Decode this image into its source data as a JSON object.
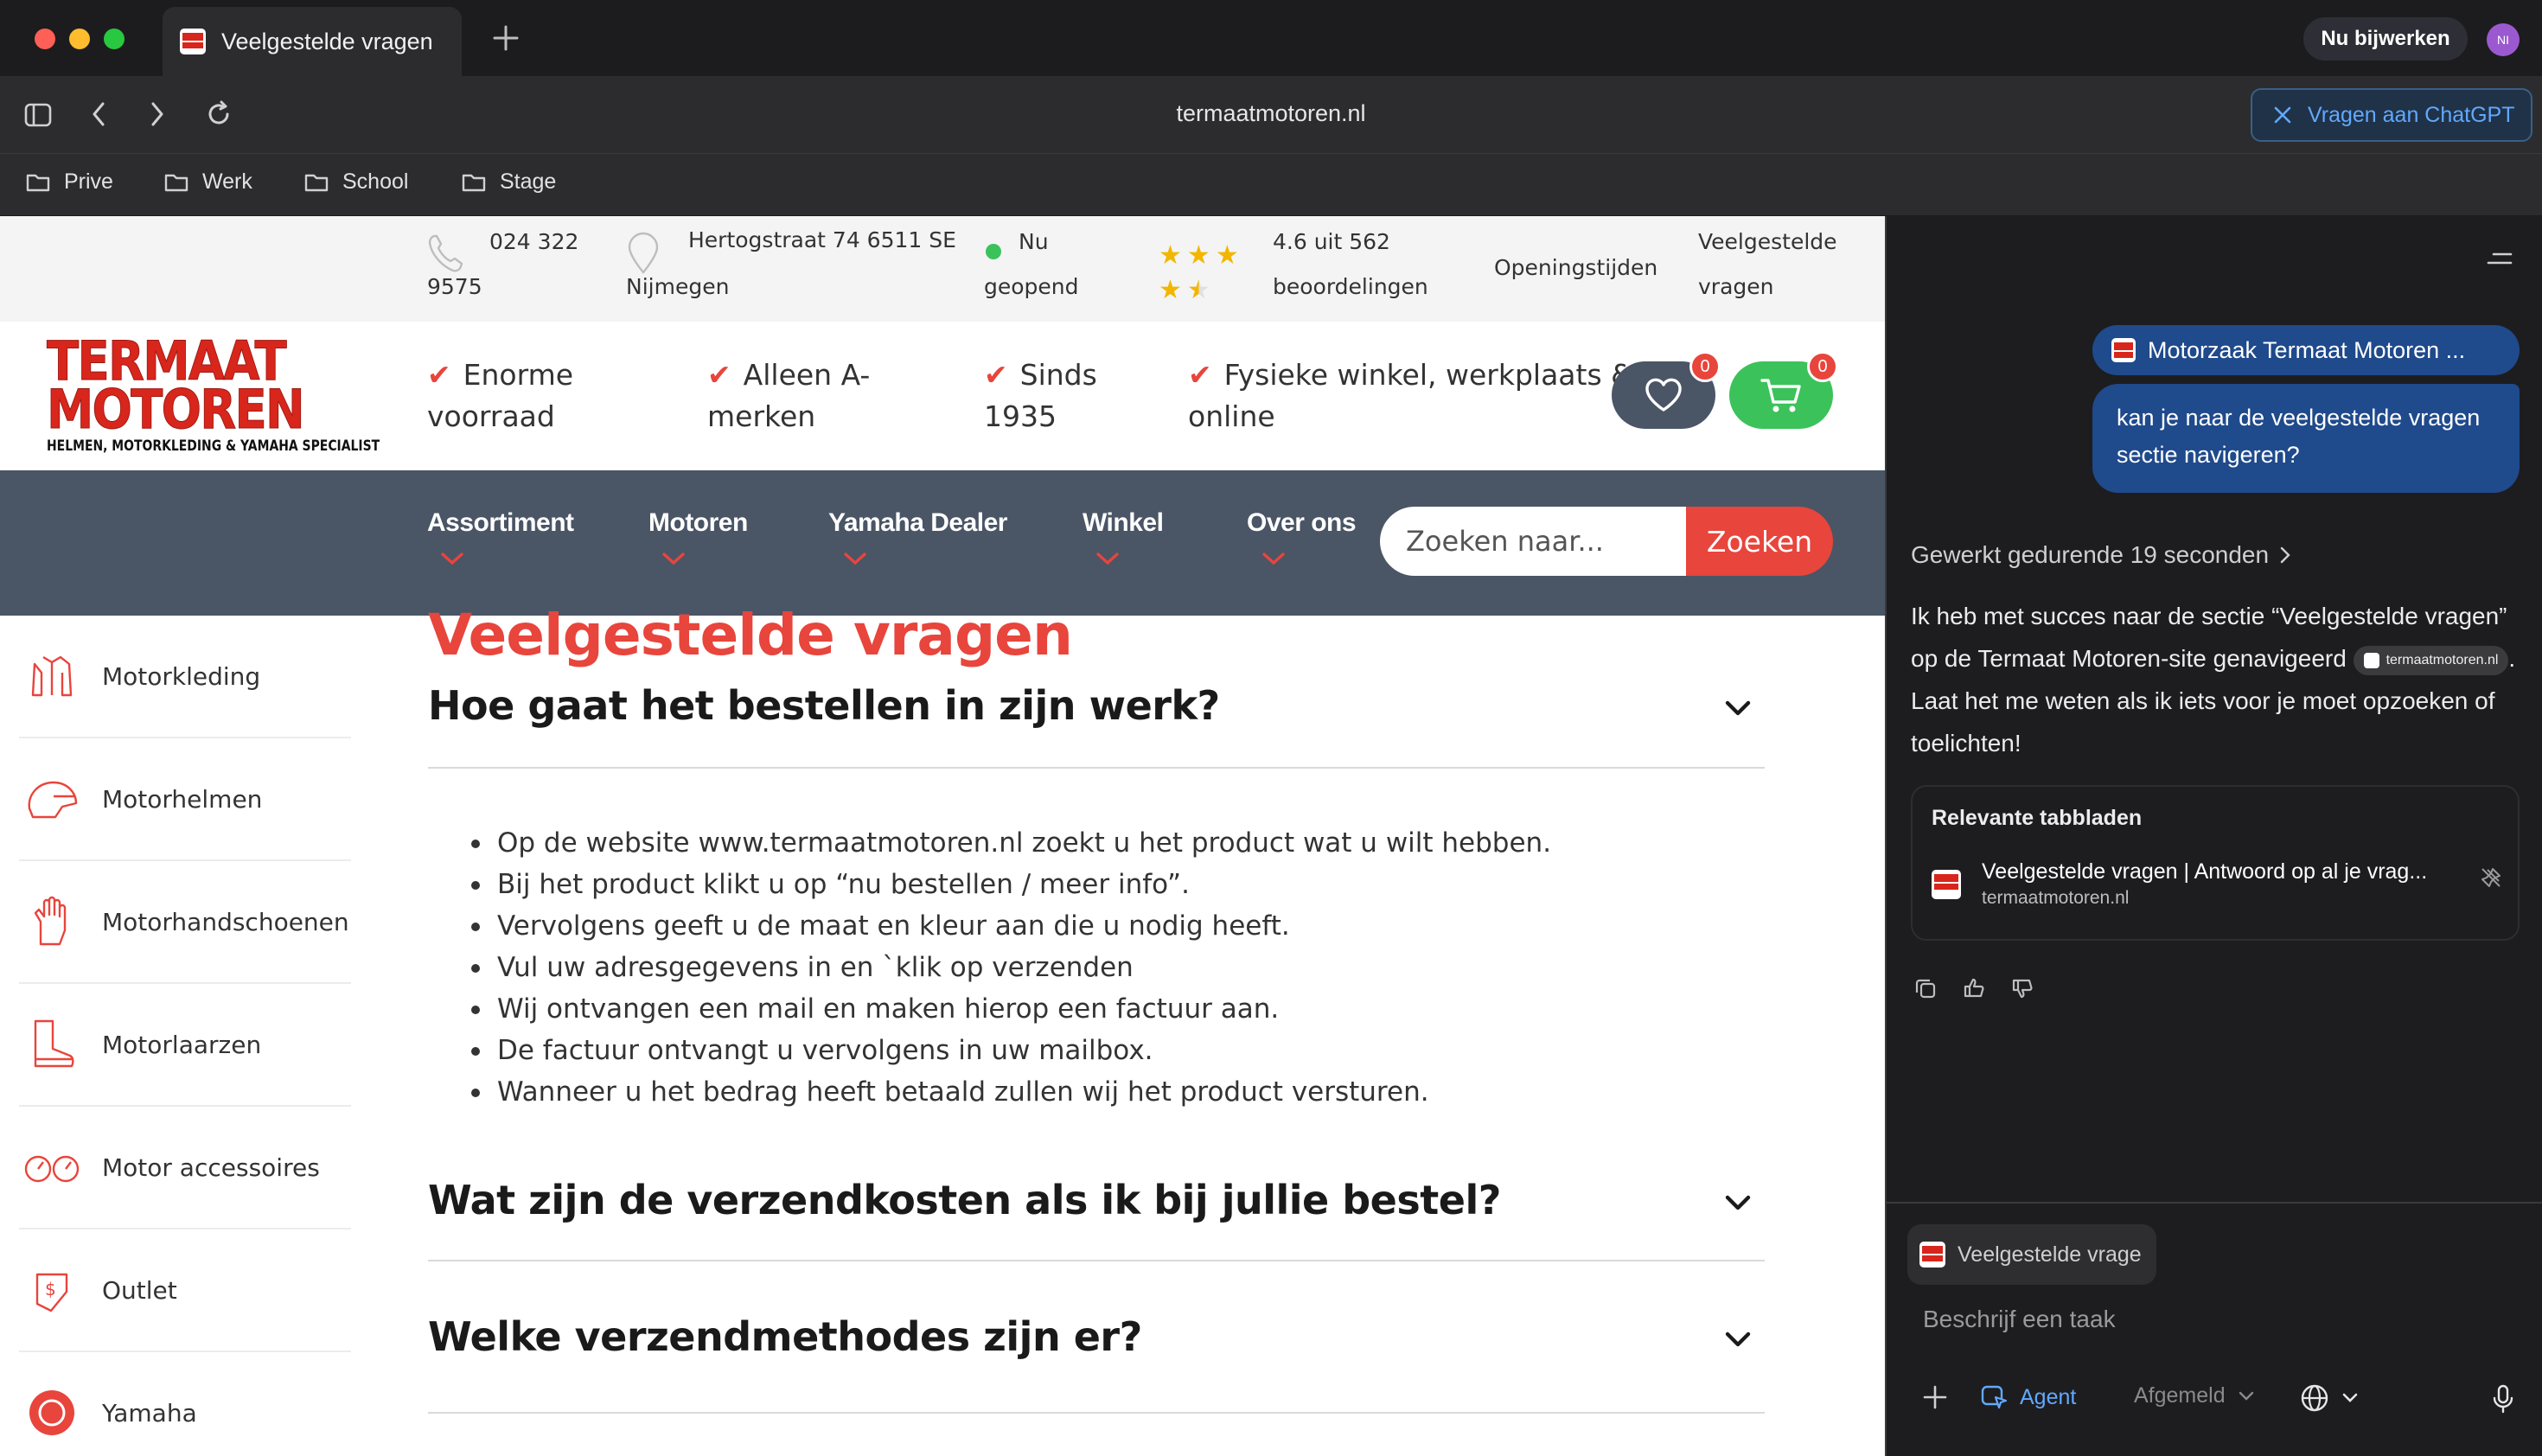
{
  "browser": {
    "tab_title": "Veelgestelde vragen",
    "update_button": "Nu bijwerken",
    "avatar_initials": "NI",
    "url": "termaatmotoren.nl",
    "ask_chatgpt": "Vragen aan ChatGPT",
    "bookmarks": [
      "Prive",
      "Werk",
      "School",
      "Stage"
    ]
  },
  "site": {
    "infobar": {
      "phone_line1": "024 322",
      "phone_line2": "9575",
      "address_line1": "Hertogstraat 74 6511 SE",
      "address_line2": "Nijmegen",
      "open_line1": "Nu",
      "open_line2": "geopend",
      "rating_line1": "4.6 uit 562",
      "rating_line2": "beoordelingen",
      "rating_value": 4.6,
      "rating_max": 5,
      "hours": "Openingstijden",
      "faq_line1": "Veelgestelde",
      "faq_line2": "vragen"
    },
    "logo": {
      "line1": "TERMAAT",
      "line2": "MOTOREN",
      "tagline": "HELMEN, MOTORKLEDING & YAMAHA SPECIALIST",
      "color": "#d8261c"
    },
    "usps": [
      {
        "line1": "Enorme",
        "line2": "voorraad"
      },
      {
        "line1": "Alleen A-",
        "line2": "merken"
      },
      {
        "line1": "Sinds",
        "line2": "1935"
      },
      {
        "line1": "Fysieke winkel, werkplaats &",
        "line2": "online"
      }
    ],
    "wishlist_count": "0",
    "cart_count": "0",
    "nav": [
      "Assortiment",
      "Motoren",
      "Yamaha Dealer",
      "Winkel",
      "Over ons"
    ],
    "search_placeholder": "Zoeken naar...",
    "search_button": "Zoeken",
    "sidebar": [
      "Motorkleding",
      "Motorhelmen",
      "Motorhandschoenen",
      "Motorlaarzen",
      "Motor accessoires",
      "Outlet",
      "Yamaha"
    ],
    "faq_title": "Veelgestelde vragen",
    "questions": [
      "Hoe gaat het bestellen in zijn werk?",
      "Wat zijn de verzendkosten als ik bij jullie bestel?",
      "Welke verzendmethodes zijn er?"
    ],
    "answer_items": [
      "Op de website www.termaatmotoren.nl zoekt u het product wat u wilt hebben.",
      "Bij het product klikt u op “nu bestellen / meer info”.",
      "Vervolgens geeft u de maat en kleur aan die u nodig heeft.",
      "Vul uw adresgegevens in en `klik op verzenden",
      "Wij ontvangen een mail en maken hierop een factuur aan.",
      "De factuur ontvangt u vervolgens in uw mailbox.",
      "Wanneer u het bedrag heeft betaald zullen wij het product versturen."
    ],
    "colors": {
      "accent": "#e8453c",
      "nav_bg": "#4a5566",
      "wishlist_bg": "#4a5566",
      "cart_bg": "#3cc25a"
    }
  },
  "chat": {
    "context_pill": "Motorzaak Termaat Motoren ...",
    "user_message": "kan je naar de veelgestelde vragen sectie navigeren?",
    "worked": "Gewerkt gedurende 19 seconden",
    "reply_part1": "Ik heb met succes naar de sectie “Veelgestelde vragen” op de Termaat Motoren-site genavigeerd",
    "reply_source": "termaatmotoren.nl",
    "reply_part2": ". Laat het me weten als ik iets voor je moet opzoeken of toelichten!",
    "relevant_title": "Relevante tabbladen",
    "relevant_tab_title": "Veelgestelde vragen | Antwoord op al je vrag...",
    "relevant_tab_url": "termaatmotoren.nl",
    "composer_tab": "Veelgestelde vrage",
    "composer_placeholder": "Beschrijf een taak",
    "agent_label": "Agent",
    "status_label": "Afgemeld"
  }
}
